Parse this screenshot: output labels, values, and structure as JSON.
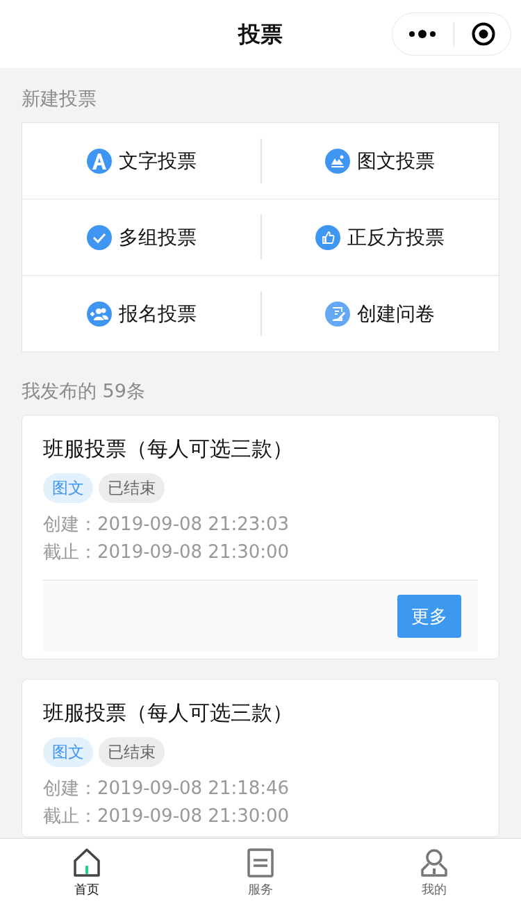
{
  "nav": {
    "title": "投票"
  },
  "create": {
    "heading": "新建投票",
    "items": [
      {
        "kind": "letter",
        "label": "文字投票"
      },
      {
        "kind": "image",
        "label": "图文投票"
      },
      {
        "kind": "check",
        "label": "多组投票"
      },
      {
        "kind": "thumb",
        "label": "正反方投票"
      },
      {
        "kind": "people",
        "label": "报名投票"
      },
      {
        "kind": "form",
        "label": "创建问卷"
      }
    ]
  },
  "mine": {
    "heading": "我发布的 59条",
    "posts": [
      {
        "title": "班服投票（每人可选三款）",
        "tags": [
          {
            "kind": "type",
            "label": "图文"
          },
          {
            "kind": "status",
            "label": "已结束"
          }
        ],
        "created": "创建：2019-09-08 21:23:03",
        "deadline": "截止：2019-09-08 21:30:00",
        "more": "更多"
      },
      {
        "title": "班服投票（每人可选三款）",
        "tags": [
          {
            "kind": "type",
            "label": "图文"
          },
          {
            "kind": "status",
            "label": "已结束"
          }
        ],
        "created": "创建：2019-09-08 21:18:46",
        "deadline": "截止：2019-09-08 21:30:00"
      }
    ]
  },
  "tabbar": [
    {
      "kind": "home",
      "label": "首页",
      "selected": true
    },
    {
      "kind": "doc",
      "label": "服务",
      "selected": false
    },
    {
      "kind": "user",
      "label": "我的",
      "selected": false
    }
  ]
}
